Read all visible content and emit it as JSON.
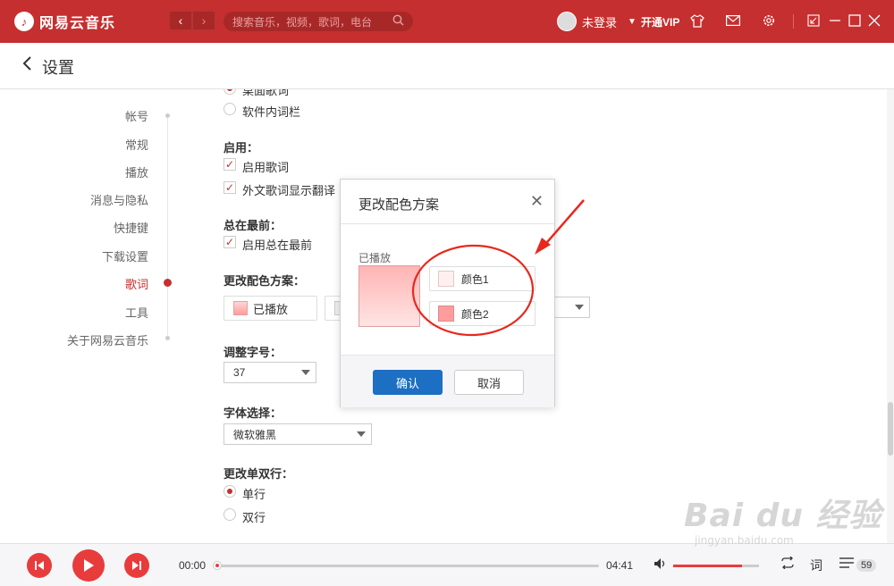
{
  "app": {
    "logo_mark": "♪",
    "name": "网易云音乐"
  },
  "nav_buttons": {
    "back": "‹",
    "forward": "›"
  },
  "search": {
    "placeholder": "搜索音乐，视频，歌词，电台"
  },
  "user": {
    "status": "未登录",
    "vip": "开通VIP"
  },
  "page": {
    "title": "设置"
  },
  "sidebar": {
    "items": [
      {
        "label": "帐号",
        "active": false
      },
      {
        "label": "常规",
        "active": false
      },
      {
        "label": "播放",
        "active": false
      },
      {
        "label": "消息与隐私",
        "active": false
      },
      {
        "label": "快捷键",
        "active": false
      },
      {
        "label": "下载设置",
        "active": false
      },
      {
        "label": "歌词",
        "active": true
      },
      {
        "label": "工具",
        "active": false
      },
      {
        "label": "关于网易云音乐",
        "active": false
      }
    ]
  },
  "lyrics": {
    "radio_top_label": "桌面歌词",
    "radio_embedded_label": "软件内词栏",
    "enable_heading": "启用：",
    "enable_lyrics_label": "启用歌词",
    "foreign_translate_label": "外文歌词显示翻译",
    "always_top_heading": "总在最前：",
    "always_top_label": "启用总在最前",
    "color_scheme_heading": "更改配色方案：",
    "played_button_label": "已播放",
    "font_size_heading": "调整字号：",
    "font_size_value": "37",
    "font_heading": "字体选择：",
    "font_value": "微软雅黑",
    "line_mode_heading": "更改单双行：",
    "single_line_label": "单行",
    "double_line_label": "双行"
  },
  "modal": {
    "title": "更改配色方案",
    "played_label": "已播放",
    "color1_label": "颜色1",
    "color2_label": "颜色2",
    "color1": "#fff0f0",
    "color2": "#ff9c9c",
    "confirm_label": "确认",
    "cancel_label": "取消"
  },
  "player": {
    "current_time": "00:00",
    "total_time": "04:41",
    "progress": 0,
    "volume_percent": 80,
    "lyrics_toggle": "词",
    "playlist_count": "59"
  },
  "watermark": {
    "brand": "Bai du 经验",
    "url": "jingyan.baidu.com"
  },
  "colors": {
    "brand_red": "#c62f2f",
    "confirm_blue": "#1c6fc3",
    "annotation_red": "#e8281e"
  }
}
